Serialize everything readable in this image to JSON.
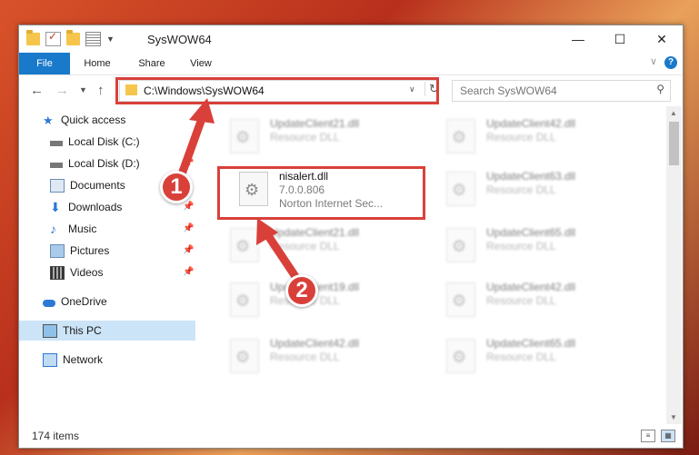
{
  "window": {
    "title": "SysWOW64"
  },
  "window_controls": {
    "minimize": "—",
    "maximize": "☐",
    "close": "✕"
  },
  "ribbon": {
    "tabs": [
      "File",
      "Home",
      "Share",
      "View"
    ],
    "help": "?"
  },
  "address": {
    "path": "C:\\Windows\\SysWOW64"
  },
  "search": {
    "placeholder": "Search SysWOW64"
  },
  "sidebar": {
    "items": [
      {
        "label": "Quick access",
        "icon": "star-icon"
      },
      {
        "label": "Local Disk (C:)",
        "icon": "drive-icon"
      },
      {
        "label": "Local Disk (D:)",
        "icon": "drive-icon"
      },
      {
        "label": "Documents",
        "icon": "documents-icon"
      },
      {
        "label": "Downloads",
        "icon": "download-icon"
      },
      {
        "label": "Music",
        "icon": "music-icon"
      },
      {
        "label": "Pictures",
        "icon": "pictures-icon"
      },
      {
        "label": "Videos",
        "icon": "videos-icon"
      },
      {
        "label": "OneDrive",
        "icon": "cloud-icon"
      },
      {
        "label": "This PC",
        "icon": "computer-icon"
      },
      {
        "label": "Network",
        "icon": "network-icon"
      }
    ]
  },
  "files": {
    "highlighted": {
      "name": "nisalert.dll",
      "version": "7.0.0.806",
      "description": "Norton Internet Sec..."
    },
    "background": [
      {
        "name": "UpdateClient21.dll",
        "type": "Resource DLL"
      },
      {
        "name": "UpdateClient42.dll",
        "type": "Resource DLL"
      },
      {
        "name": "UpdateClient63.dll",
        "type": "Resource DLL"
      },
      {
        "name": "UpdateClient21.dll",
        "type": "Resource DLL"
      },
      {
        "name": "UpdateClient65.dll",
        "type": "Resource DLL"
      },
      {
        "name": "UpdateClient19.dll",
        "type": "Resource DLL"
      },
      {
        "name": "UpdateClient42.dll",
        "type": "Resource DLL"
      },
      {
        "name": "UpdateClient42.dll",
        "type": "Resource DLL"
      },
      {
        "name": "UpdateClient65.dll",
        "type": "Resource DLL"
      }
    ]
  },
  "status": {
    "item_count": "174 items"
  },
  "callouts": [
    "1",
    "2"
  ],
  "colors": {
    "accent": "#1979ca",
    "highlight_red": "#d9403a",
    "selected_bg": "#cce4f7"
  }
}
